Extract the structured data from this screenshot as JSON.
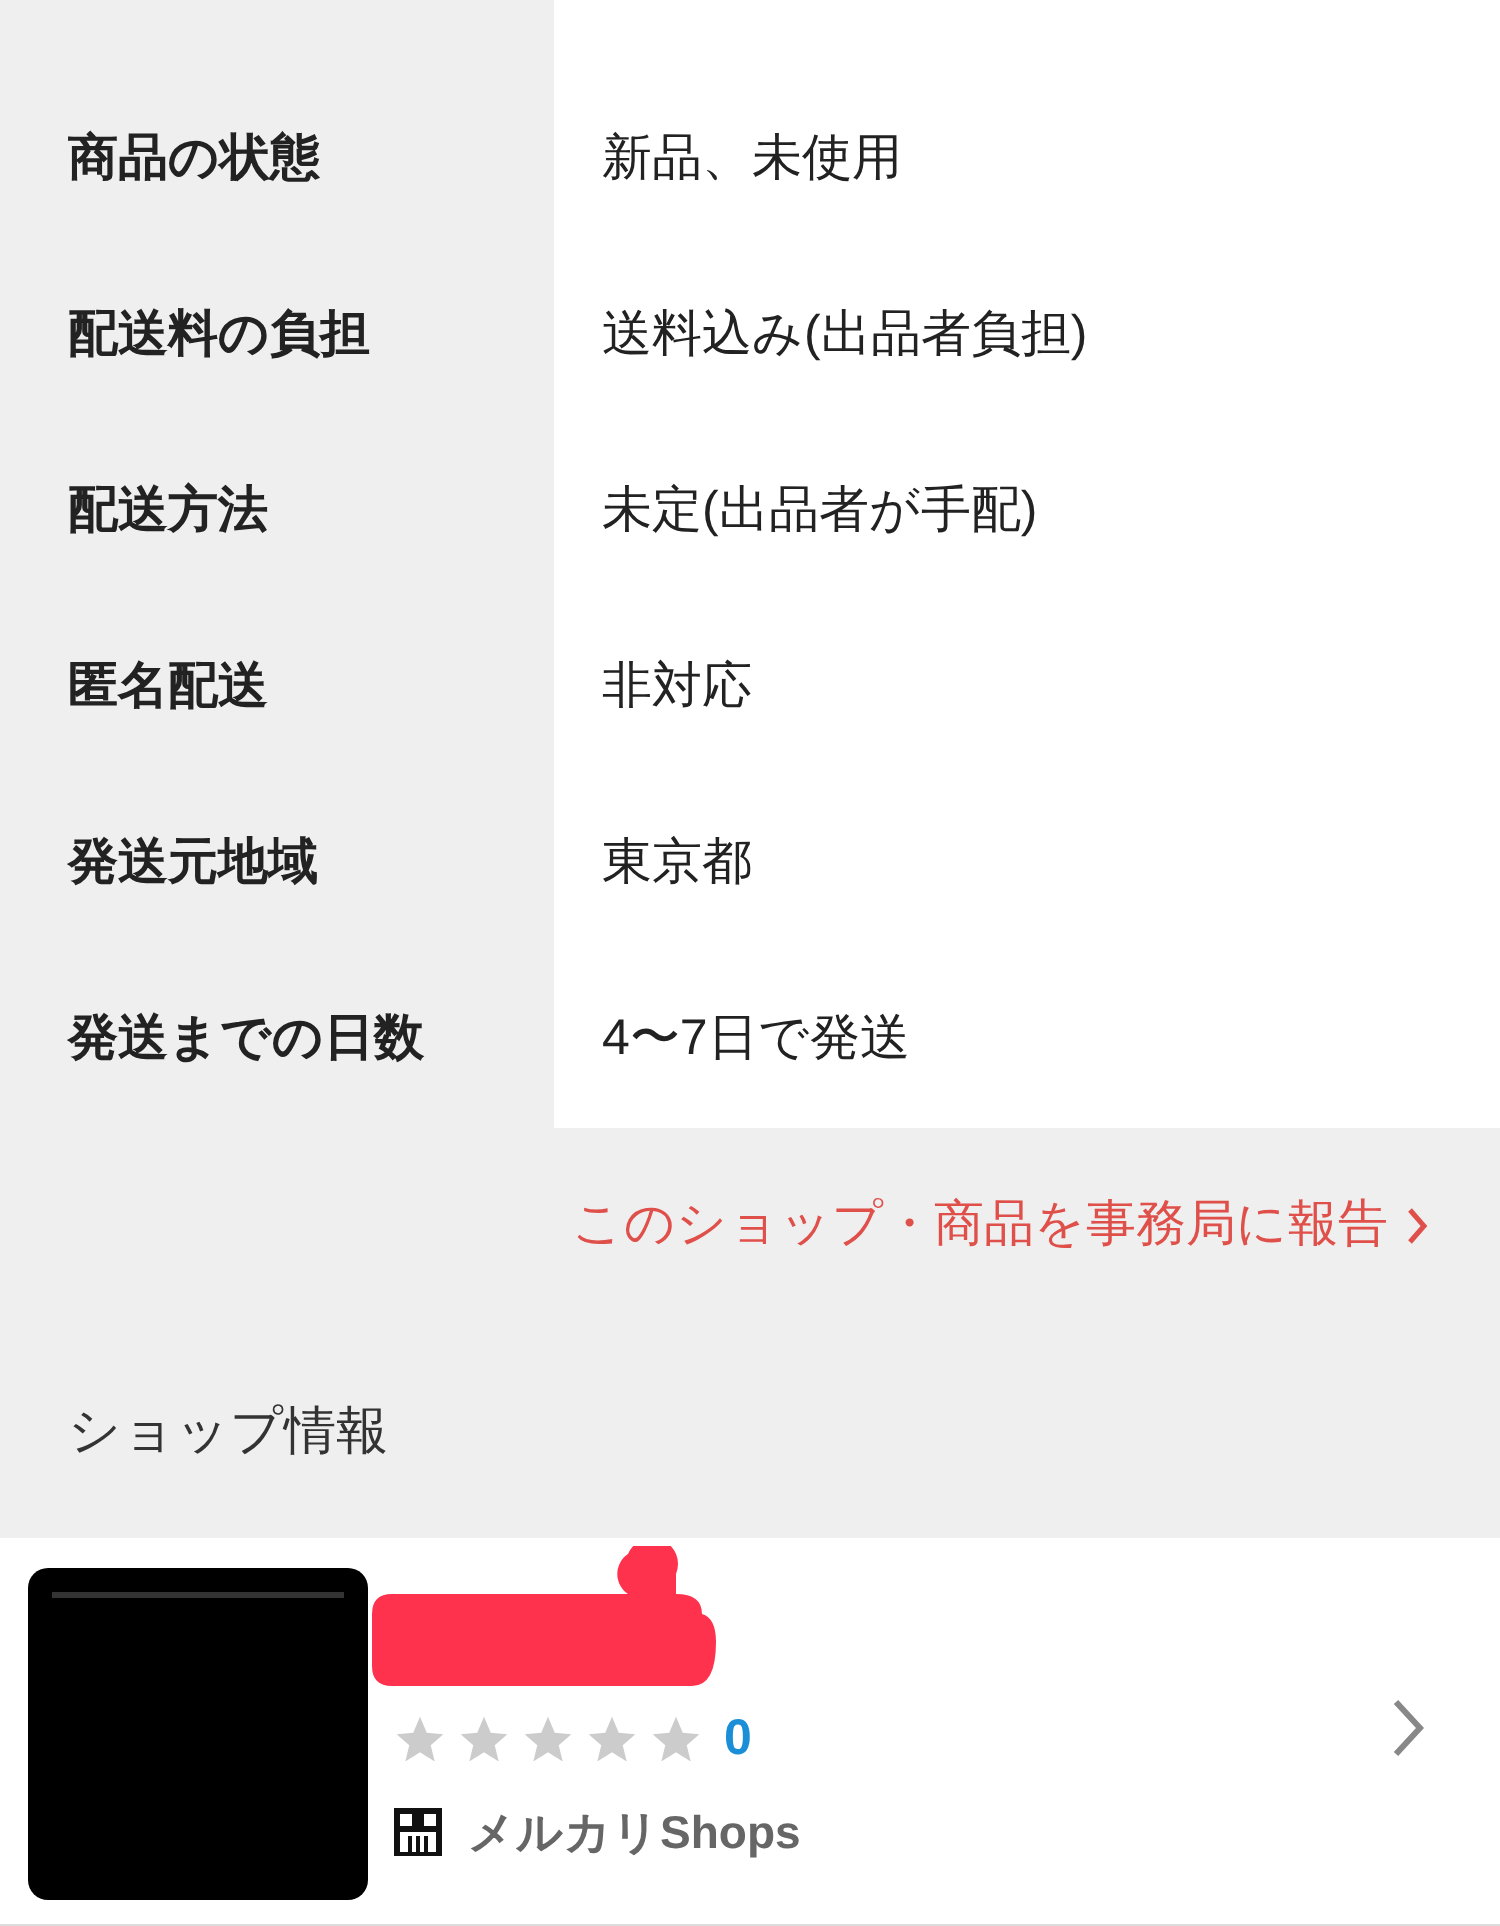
{
  "details": [
    {
      "label": "商品の状態",
      "value": "新品、未使用"
    },
    {
      "label": "配送料の負担",
      "value": "送料込み(出品者負担)"
    },
    {
      "label": "配送方法",
      "value": "未定(出品者が手配)"
    },
    {
      "label": "匿名配送",
      "value": "非対応"
    },
    {
      "label": "発送元地域",
      "value": "東京都"
    },
    {
      "label": "発送までの日数",
      "value": "4〜7日で発送"
    }
  ],
  "report_link": "このショップ・商品を事務局に報告",
  "shop_section_title": "ショップ情報",
  "shop": {
    "stars": 0,
    "review_count": "0",
    "badge": "メルカリShops"
  }
}
